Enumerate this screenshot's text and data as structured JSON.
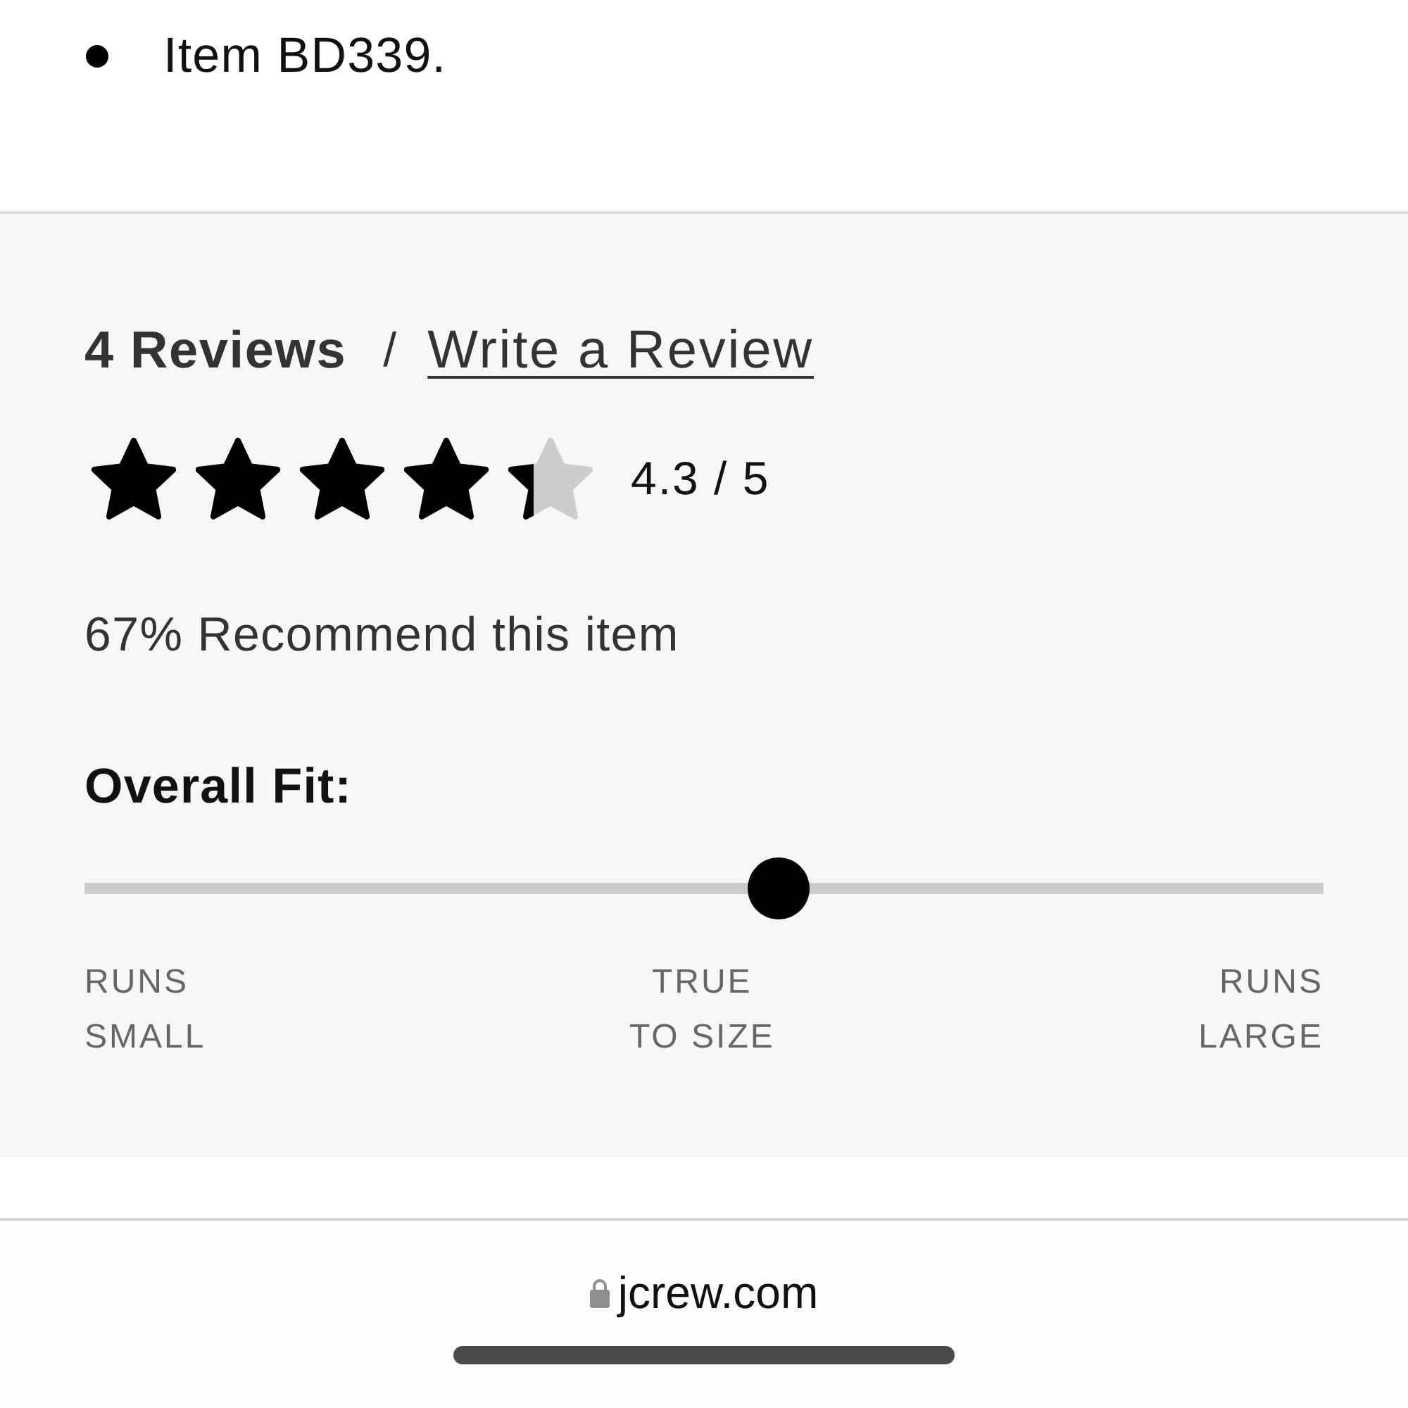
{
  "details": {
    "bullets": [
      "Item BD339."
    ]
  },
  "reviews": {
    "count_label": "4 Reviews",
    "separator": "/",
    "write_link": "Write a Review",
    "stars": 4.3,
    "rating": "4.3 / 5",
    "recommend": "67% Recommend this item"
  },
  "fit": {
    "title": "Overall Fit:",
    "level": 0.56,
    "labels": [
      {
        "lines": [
          "RUNS",
          "SMALL"
        ]
      },
      {
        "lines": [
          "TRUE",
          "TO SIZE"
        ]
      },
      {
        "lines": [
          "RUNS",
          "LARGE"
        ]
      }
    ]
  },
  "browser": {
    "url": "jcrew.com"
  }
}
